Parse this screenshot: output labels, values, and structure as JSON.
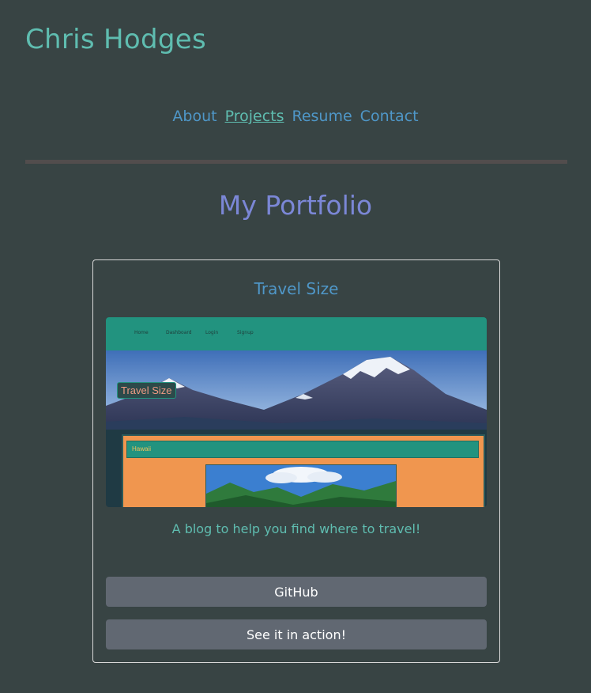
{
  "header": {
    "site_title": "Chris Hodges"
  },
  "nav": {
    "items": [
      {
        "label": "About",
        "active": false
      },
      {
        "label": "Projects",
        "active": true
      },
      {
        "label": "Resume",
        "active": false
      },
      {
        "label": "Contact",
        "active": false
      }
    ]
  },
  "main": {
    "heading": "My Portfolio",
    "projects": [
      {
        "title": "Travel Size",
        "description": "A blog to help you find where to travel!",
        "buttons": {
          "github": "GitHub",
          "live": "See it in action!"
        },
        "screenshot": {
          "nav_items": [
            "Home",
            "Dashboard",
            "Login",
            "Signup"
          ],
          "logo_text": "Travel Size",
          "post_title": "Hawaii"
        }
      }
    ]
  },
  "colors": {
    "background": "#384444",
    "title": "#5fbdb0",
    "link": "#4f97c8",
    "heading": "#7b87d6",
    "button": "#616872",
    "divider": "#524d4d"
  }
}
